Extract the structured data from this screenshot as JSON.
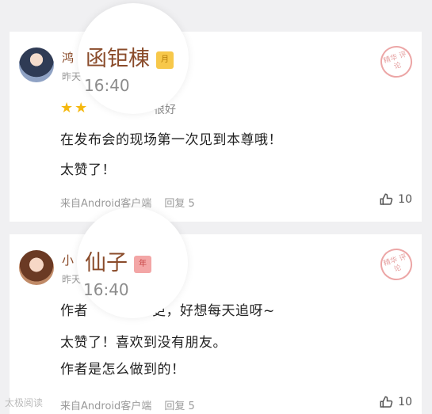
{
  "comments": [
    {
      "user_name": "鸿",
      "time": "昨天",
      "lens_name": "函钜棟",
      "lens_badge": "月",
      "lens_time": "16:40",
      "rating_label": "很好",
      "lines": [
        "在发布会的现场第一次见到本尊哦！",
        "太赞了！"
      ],
      "source": "来自Android客户端",
      "reply": "回复 5",
      "likes": "10",
      "stamp": "精华\n评论"
    },
    {
      "user_name": "小",
      "time": "昨天",
      "lens_name": "仙子",
      "lens_badge": "年",
      "lens_time": "16:40",
      "lines": [
        "作者",
        "天一更，好想每天追呀~",
        "太赞了！喜欢到没有朋友。",
        "作者是怎么做到的！"
      ],
      "source": "来自Android客户端",
      "reply": "回复 5",
      "likes": "10",
      "stamp": "精华\n评论"
    }
  ],
  "watermark": "太极阅读",
  "colors": {
    "accent_name": "#8a4b2a",
    "star": "#f5b80e",
    "stamp": "#e6a2a2"
  },
  "icons": [
    "thumbs-up-icon",
    "star-icon",
    "month-badge",
    "year-badge"
  ]
}
